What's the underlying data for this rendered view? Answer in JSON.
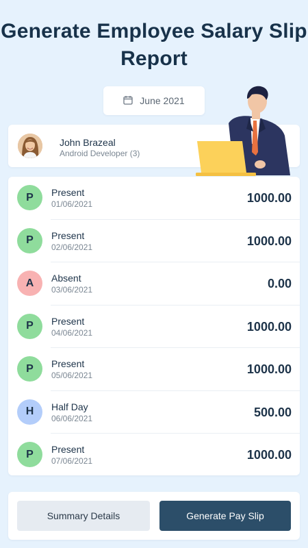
{
  "header": {
    "line1": "Generate Employee Salary Slip",
    "line2": "Report"
  },
  "month_selector": {
    "icon": "calendar-icon",
    "label": "June 2021"
  },
  "employee": {
    "name": "John Brazeal",
    "role": "Android Developer (3)"
  },
  "attendance": [
    {
      "code": "P",
      "status": "Present",
      "date": "01/06/2021",
      "amount": "1000.00",
      "badge_color": "#8fdc9c"
    },
    {
      "code": "P",
      "status": "Present",
      "date": "02/06/2021",
      "amount": "1000.00",
      "badge_color": "#8fdc9c"
    },
    {
      "code": "A",
      "status": "Absent",
      "date": "03/06/2021",
      "amount": "0.00",
      "badge_color": "#f8b2b2"
    },
    {
      "code": "P",
      "status": "Present",
      "date": "04/06/2021",
      "amount": "1000.00",
      "badge_color": "#8fdc9c"
    },
    {
      "code": "P",
      "status": "Present",
      "date": "05/06/2021",
      "amount": "1000.00",
      "badge_color": "#8fdc9c"
    },
    {
      "code": "H",
      "status": "Half Day",
      "date": "06/06/2021",
      "amount": "500.00",
      "badge_color": "#b3cdfa"
    },
    {
      "code": "P",
      "status": "Present",
      "date": "07/06/2021",
      "amount": "1000.00",
      "badge_color": "#8fdc9c"
    }
  ],
  "actions": {
    "summary_label": "Summary Details",
    "generate_label": "Generate Pay Slip"
  },
  "colors": {
    "background": "#e6f2fd",
    "primary": "#2c4e69",
    "present": "#8fdc9c",
    "absent": "#f8b2b2",
    "half_day": "#b3cdfa"
  }
}
